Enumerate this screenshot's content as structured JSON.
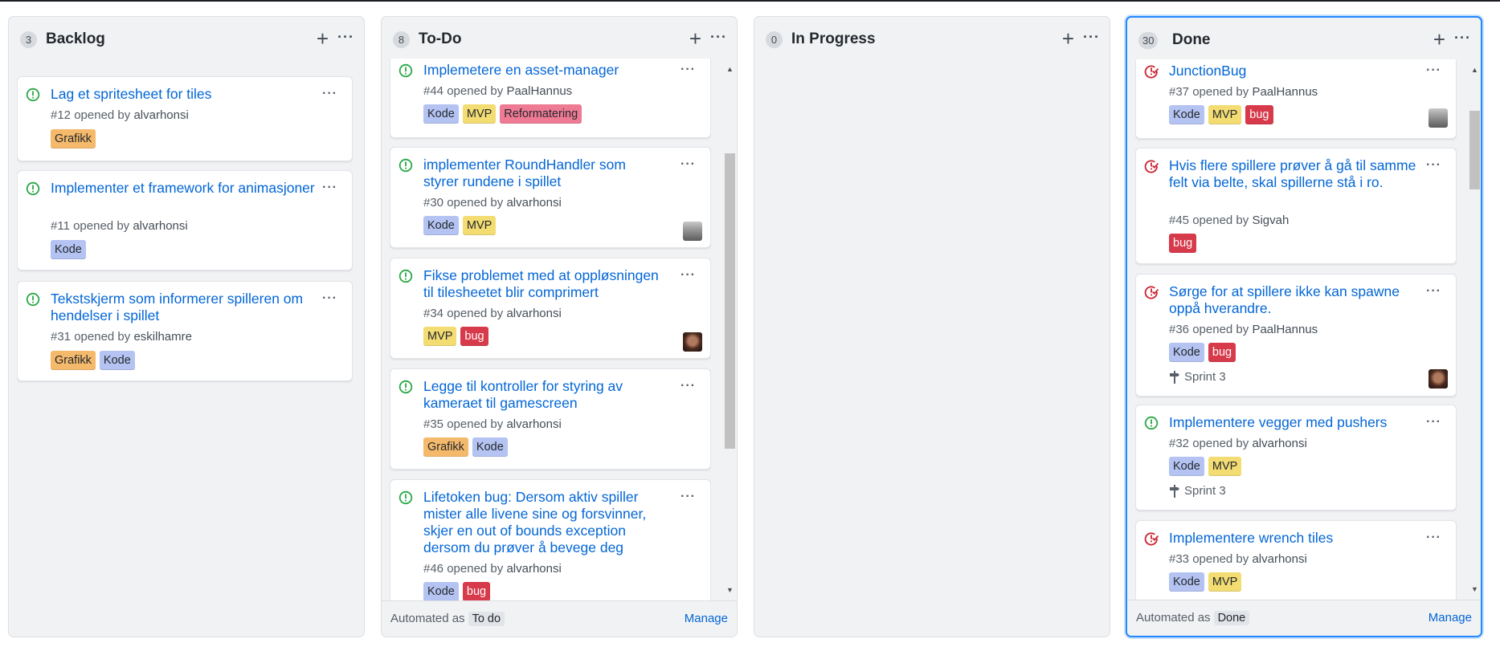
{
  "columns": [
    {
      "count": "3",
      "title": "Backlog",
      "cards": [
        {
          "title": "Lag et spritesheet for tiles",
          "number": "#12",
          "opened_by": "opened by",
          "author": "alvarhonsi",
          "labels": [
            "Grafikk"
          ]
        },
        {
          "title": "Implementer et framework for animasjoner",
          "number": "#11",
          "opened_by": "opened by",
          "author": "alvarhonsi",
          "labels": [
            "Kode"
          ]
        },
        {
          "title": "Tekstskjerm som informerer spilleren om hendelser i spillet",
          "number": "#31",
          "opened_by": "opened by",
          "author": "eskilhamre",
          "labels": [
            "Grafikk",
            "Kode"
          ]
        }
      ]
    },
    {
      "count": "8",
      "title": "To-Do",
      "cards": [
        {
          "title": "Implemetere en asset-manager",
          "number": "#44",
          "opened_by": "opened by",
          "author": "PaalHannus",
          "labels": [
            "Kode",
            "MVP",
            "Reformatering"
          ]
        },
        {
          "title": "implementer RoundHandler som styrer rundene i spillet",
          "number": "#30",
          "opened_by": "opened by",
          "author": "alvarhonsi",
          "labels": [
            "Kode",
            "MVP"
          ]
        },
        {
          "title": "Fikse problemet med at oppløsningen til tilesheetet blir comprimert",
          "number": "#34",
          "opened_by": "opened by",
          "author": "alvarhonsi",
          "labels": [
            "MVP",
            "bug"
          ]
        },
        {
          "title": "Legge til kontroller for styring av kameraet til gamescreen",
          "number": "#35",
          "opened_by": "opened by",
          "author": "alvarhonsi",
          "labels": [
            "Grafikk",
            "Kode"
          ]
        },
        {
          "title": "Lifetoken bug: Dersom aktiv spiller mister alle livene sine og forsvinner, skjer en out of bounds exception dersom du prøver å bevege deg",
          "number": "#46",
          "opened_by": "opened by",
          "author": "alvarhonsi",
          "labels": [
            "Kode",
            "bug"
          ]
        }
      ],
      "footer": {
        "prefix": "Automated as",
        "chip": "To do",
        "manage": "Manage"
      }
    },
    {
      "count": "0",
      "title": "In Progress",
      "cards": []
    },
    {
      "count": "30",
      "title": "Done",
      "cards": [
        {
          "title": "JunctionBug",
          "number": "#37",
          "opened_by": "opened by",
          "author": "PaalHannus",
          "labels": [
            "Kode",
            "MVP",
            "bug"
          ]
        },
        {
          "title": "Hvis flere spillere prøver å gå til samme felt via belte, skal spillerne stå i ro.",
          "number": "#45",
          "opened_by": "opened by",
          "author": "Sigvah",
          "labels": [
            "bug"
          ]
        },
        {
          "title": "Sørge for at spillere ikke kan spawne oppå hverandre.",
          "number": "#36",
          "opened_by": "opened by",
          "author": "PaalHannus",
          "labels": [
            "Kode",
            "bug"
          ],
          "milestone": "Sprint 3"
        },
        {
          "title": "Implementere vegger med pushers",
          "number": "#32",
          "opened_by": "opened by",
          "author": "alvarhonsi",
          "labels": [
            "Kode",
            "MVP"
          ],
          "milestone": "Sprint 3"
        },
        {
          "title": "Implementere wrench tiles",
          "number": "#33",
          "opened_by": "opened by",
          "author": "alvarhonsi",
          "labels": [
            "Kode",
            "MVP"
          ]
        }
      ],
      "footer": {
        "prefix": "Automated as",
        "chip": "Done",
        "manage": "Manage"
      }
    }
  ],
  "icons": {
    "add": "plus-icon",
    "more": "kebab-icon",
    "open_issue": "issue-opened-icon",
    "closed_issue": "issue-closed-icon",
    "milestone": "milestone-icon"
  },
  "colors": {
    "open": "#28a745",
    "closed": "#cb2431",
    "link": "#0366d6",
    "selected_border": "#2188ff"
  }
}
